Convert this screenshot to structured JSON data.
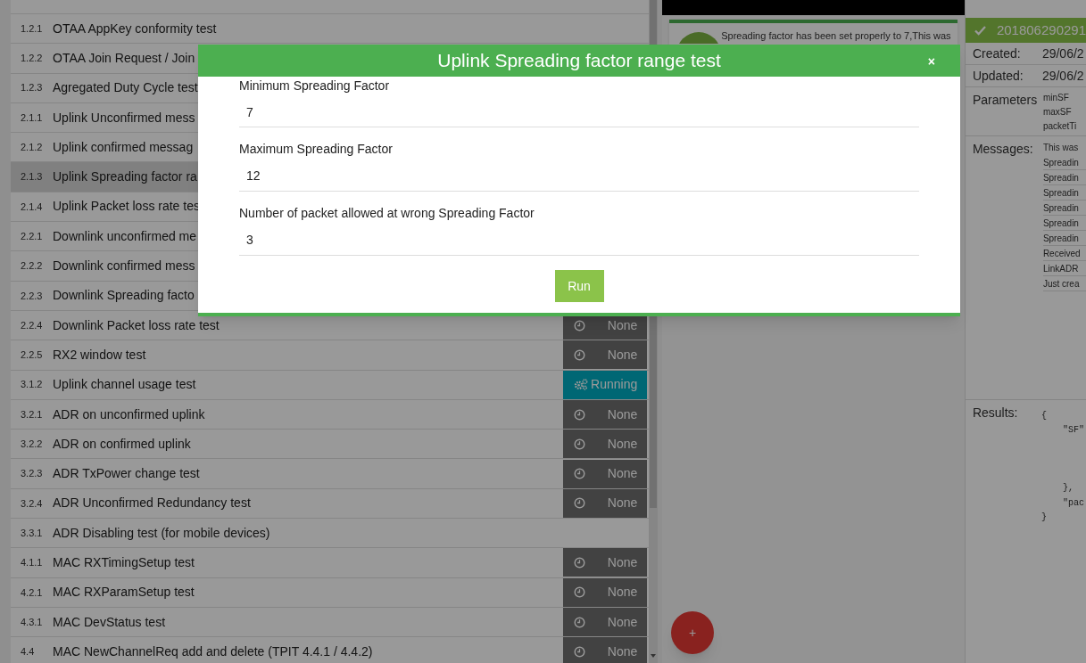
{
  "tests": [
    {
      "number": "1.2.1",
      "name": "OTAA AppKey conformity test",
      "selected": false
    },
    {
      "number": "1.2.2",
      "name": "OTAA Join Request / Join",
      "selected": false
    },
    {
      "number": "1.2.3",
      "name": "Agregated Duty Cycle test",
      "selected": false
    },
    {
      "number": "2.1.1",
      "name": "Uplink Unconfirmed mess",
      "selected": false
    },
    {
      "number": "2.1.2",
      "name": "Uplink confirmed messag",
      "selected": false
    },
    {
      "number": "2.1.3",
      "name": "Uplink Spreading factor ra",
      "selected": true
    },
    {
      "number": "2.1.4",
      "name": "Uplink Packet loss rate tes",
      "selected": false
    },
    {
      "number": "2.2.1",
      "name": "Downlink unconfirmed me",
      "selected": false
    },
    {
      "number": "2.2.2",
      "name": "Downlink confirmed mess",
      "selected": false
    },
    {
      "number": "2.2.3",
      "name": "Downlink Spreading facto",
      "selected": false
    },
    {
      "number": "2.2.4",
      "name": "Downlink Packet loss rate test",
      "selected": false,
      "status": {
        "kind": "none",
        "label": "None"
      }
    },
    {
      "number": "2.2.5",
      "name": "RX2 window test",
      "selected": false,
      "status": {
        "kind": "none",
        "label": "None"
      }
    },
    {
      "number": "3.1.2",
      "name": "Uplink channel usage test",
      "selected": false,
      "status": {
        "kind": "running",
        "label": "Running"
      }
    },
    {
      "number": "3.2.1",
      "name": "ADR on unconfirmed uplink",
      "selected": false,
      "status": {
        "kind": "none",
        "label": "None"
      }
    },
    {
      "number": "3.2.2",
      "name": "ADR on confirmed uplink",
      "selected": false,
      "status": {
        "kind": "none",
        "label": "None"
      }
    },
    {
      "number": "3.2.3",
      "name": "ADR TxPower change test",
      "selected": false,
      "status": {
        "kind": "none",
        "label": "None"
      }
    },
    {
      "number": "3.2.4",
      "name": "ADR Unconfirmed Redundancy test",
      "selected": false,
      "status": {
        "kind": "none",
        "label": "None"
      }
    },
    {
      "number": "3.3.1",
      "name": "ADR Disabling test (for mobile devices)",
      "selected": false
    },
    {
      "number": "4.1.1",
      "name": "MAC RXTimingSetup test",
      "selected": false,
      "status": {
        "kind": "none",
        "label": "None"
      }
    },
    {
      "number": "4.2.1",
      "name": "MAC RXParamSetup test",
      "selected": false,
      "status": {
        "kind": "none",
        "label": "None"
      }
    },
    {
      "number": "4.3.1",
      "name": "MAC DevStatus test",
      "selected": false,
      "status": {
        "kind": "none",
        "label": "None"
      }
    },
    {
      "number": "4.4",
      "name": "MAC NewChannelReq add and delete (TPIT 4.4.1 / 4.4.2)",
      "selected": false,
      "status": {
        "kind": "none",
        "label": "None"
      }
    }
  ],
  "detail": {
    "message": "Spreading factor has been set properly to 7,This was",
    "fab": "+"
  },
  "result": {
    "id": "201806290291",
    "created_label": "Created:",
    "created": "29/06/2",
    "updated_label": "Updated:",
    "updated": "29/06/2",
    "parameters_label": "Parameters",
    "parameters": [
      "minSF",
      "maxSF",
      "packetTi"
    ],
    "messages_label": "Messages:",
    "messages": [
      "This was",
      "Spreadin",
      "Spreadin",
      "Spreadin",
      "Spreadin",
      "Spreadin",
      "Spreadin",
      "Received",
      "LinkADR",
      "Just crea"
    ],
    "results_label": "Results:",
    "results": "{\n    \"SF\"\n\n\n\n    },\n    \"pac\n}"
  },
  "modal": {
    "title": "Uplink Spreading factor range test",
    "close": "×",
    "fields": [
      {
        "label": "Minimum Spreading Factor",
        "value": "7"
      },
      {
        "label": "Maximum Spreading Factor",
        "value": "12"
      },
      {
        "label": "Number of packet allowed at wrong Spreading Factor",
        "value": "3"
      }
    ],
    "button": "Run"
  }
}
